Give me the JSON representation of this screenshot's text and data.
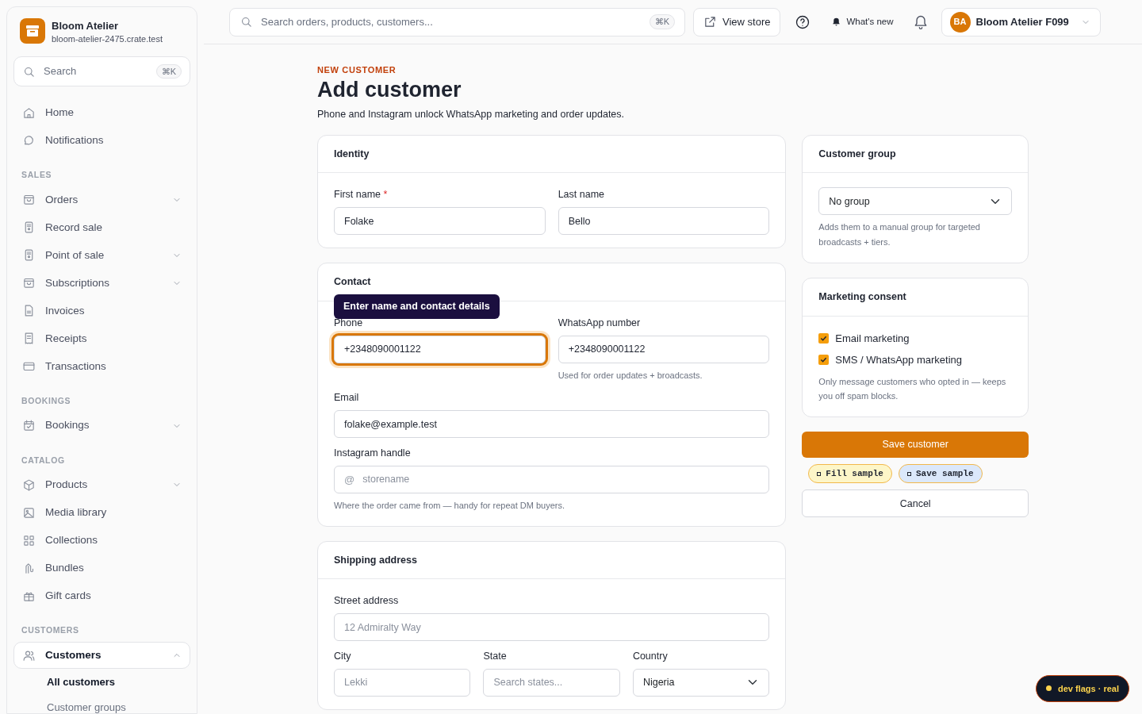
{
  "brand": {
    "name": "Bloom Atelier",
    "domain": "bloom-atelier-2475.crate.test"
  },
  "sidebar_search": {
    "placeholder": "Search",
    "shortcut": "⌘K"
  },
  "sidebar": [
    {
      "items": [
        {
          "label": "Home",
          "expandable": false,
          "selected": false
        },
        {
          "label": "Notifications",
          "expandable": false,
          "selected": false
        }
      ]
    },
    {
      "heading": "SALES",
      "items": [
        {
          "label": "Orders",
          "expandable": true,
          "expanded": false,
          "selected": false
        },
        {
          "label": "Record sale",
          "expandable": false,
          "selected": false
        },
        {
          "label": "Point of sale",
          "expandable": true,
          "expanded": false,
          "selected": false
        },
        {
          "label": "Subscriptions",
          "expandable": true,
          "expanded": false,
          "selected": false
        },
        {
          "label": "Invoices",
          "expandable": false,
          "selected": false
        },
        {
          "label": "Receipts",
          "expandable": false,
          "selected": false
        },
        {
          "label": "Transactions",
          "expandable": false,
          "selected": false
        }
      ]
    },
    {
      "heading": "BOOKINGS",
      "items": [
        {
          "label": "Bookings",
          "expandable": true,
          "expanded": false,
          "selected": false
        }
      ]
    },
    {
      "heading": "CATALOG",
      "items": [
        {
          "label": "Products",
          "expandable": true,
          "expanded": false,
          "selected": false
        },
        {
          "label": "Media library",
          "expandable": false,
          "selected": false
        },
        {
          "label": "Collections",
          "expandable": false,
          "selected": false
        },
        {
          "label": "Bundles",
          "expandable": false,
          "selected": false
        },
        {
          "label": "Gift cards",
          "expandable": false,
          "selected": false
        }
      ]
    },
    {
      "heading": "CUSTOMERS",
      "items": [
        {
          "label": "Customers",
          "expandable": true,
          "expanded": true,
          "selected": true,
          "children": [
            {
              "label": "All customers",
              "selected": true
            },
            {
              "label": "Customer groups",
              "selected": false
            }
          ]
        }
      ]
    }
  ],
  "topbar": {
    "search": {
      "placeholder": "Search orders, products, customers...",
      "shortcut": "⌘K"
    },
    "view_store": "View store",
    "whats_new": "What's new",
    "account": {
      "initials": "BA",
      "name": "Bloom Atelier F099"
    }
  },
  "header": {
    "eyebrow": "NEW CUSTOMER",
    "title": "Add customer",
    "subtitle": "Phone and Instagram unlock WhatsApp marketing and order updates."
  },
  "cards": [
    {
      "title": "Identity",
      "rows": [
        [
          {
            "label": "First name",
            "required_mark": "*",
            "kind": "text",
            "value": "Folake"
          },
          {
            "label": "Last name",
            "kind": "text",
            "value": "Bello"
          }
        ]
      ]
    },
    {
      "title": "Contact",
      "tooltip": "Enter name and contact details",
      "rows": [
        [
          {
            "label": "Phone",
            "kind": "text",
            "value": "+2348090001122",
            "focused": true
          },
          {
            "label": "WhatsApp number",
            "kind": "text",
            "value": "+2348090001122",
            "help": "Used for order updates + broadcasts."
          }
        ],
        [
          {
            "label": "Email",
            "kind": "text",
            "value": "folake@example.test"
          }
        ],
        [
          {
            "label": "Instagram handle",
            "kind": "prefixed",
            "prefix": "@",
            "placeholder": "storename",
            "help": "Where the order came from — handy for repeat DM buyers."
          }
        ]
      ]
    },
    {
      "title": "Shipping address",
      "rows": [
        [
          {
            "label": "Street address",
            "kind": "text",
            "placeholder": "12 Admiralty Way"
          }
        ],
        [
          {
            "label": "City",
            "kind": "text",
            "placeholder": "Lekki"
          },
          {
            "label": "State",
            "kind": "text",
            "placeholder": "Search states..."
          },
          {
            "label": "Country",
            "kind": "select",
            "value": "Nigeria"
          }
        ]
      ]
    }
  ],
  "customer_group": {
    "title": "Customer group",
    "value": "No group",
    "help": "Adds them to a manual group for targeted broadcasts + tiers."
  },
  "marketing": {
    "title": "Marketing consent",
    "options": [
      {
        "label": "Email marketing",
        "checked": true
      },
      {
        "label": "SMS / WhatsApp marketing",
        "checked": true
      }
    ],
    "help": "Only message customers who opted in — keeps you off spam blocks."
  },
  "actions": {
    "save": "Save customer",
    "samples": [
      {
        "label": "Fill sample",
        "color": "#fdf6c8"
      },
      {
        "label": "Save sample",
        "color": "#dbe8fb"
      }
    ],
    "cancel": "Cancel"
  },
  "dev_badge": "dev flags · real"
}
